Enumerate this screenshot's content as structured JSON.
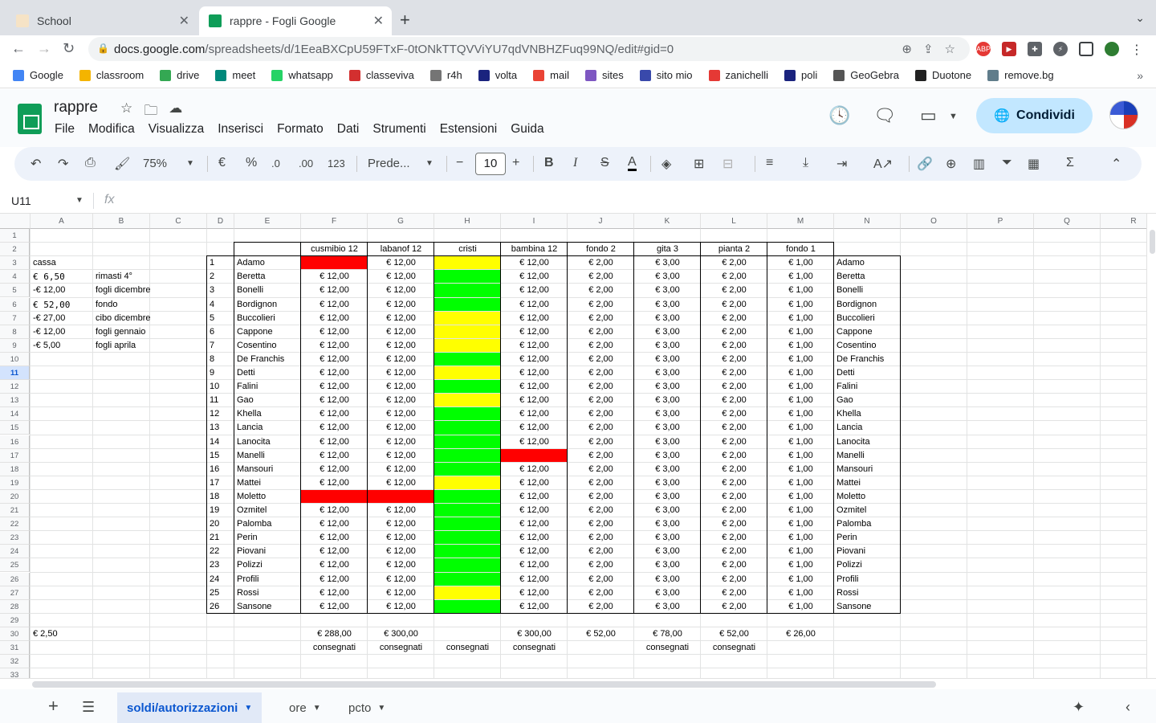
{
  "browser": {
    "tabs": [
      {
        "title": "School",
        "active": false
      },
      {
        "title": "rappre - Fogli Google",
        "active": true
      }
    ],
    "url_host": "docs.google.com",
    "url_path": "/spreadsheets/d/1EeaBXCpU59FTxF-0tONkTTQVViYU7qdVNBHZFuq99NQ/edit#gid=0",
    "bookmarks": [
      {
        "label": "Google",
        "color": "#4285f4"
      },
      {
        "label": "classroom",
        "color": "#f4b400"
      },
      {
        "label": "drive",
        "color": "#34a853"
      },
      {
        "label": "meet",
        "color": "#00897b"
      },
      {
        "label": "whatsapp",
        "color": "#25d366"
      },
      {
        "label": "classeviva",
        "color": "#d32f2f"
      },
      {
        "label": "r4h",
        "color": "#757575"
      },
      {
        "label": "volta",
        "color": "#1a237e"
      },
      {
        "label": "mail",
        "color": "#ea4335"
      },
      {
        "label": "sites",
        "color": "#7e57c2"
      },
      {
        "label": "sito mio",
        "color": "#3949ab"
      },
      {
        "label": "zanichelli",
        "color": "#e53935"
      },
      {
        "label": "poli",
        "color": "#1a237e"
      },
      {
        "label": "GeoGebra",
        "color": "#555555"
      },
      {
        "label": "Duotone",
        "color": "#212121"
      },
      {
        "label": "remove.bg",
        "color": "#607d8b"
      }
    ]
  },
  "doc": {
    "title": "rappre",
    "menu": [
      "File",
      "Modifica",
      "Visualizza",
      "Inserisci",
      "Formato",
      "Dati",
      "Strumenti",
      "Estensioni",
      "Guida"
    ],
    "share_label": "Condividi"
  },
  "toolbar": {
    "zoom": "75%",
    "currency": "€",
    "percent": "%",
    "dec_less": ".0",
    "dec_more": ".00",
    "format_123": "123",
    "font": "Prede...",
    "font_size": "10"
  },
  "formula_bar": {
    "name_box": "U11",
    "fx": "fx",
    "selected_row": 11
  },
  "sheet": {
    "columns": [
      "A",
      "B",
      "C",
      "D",
      "E",
      "F",
      "G",
      "H",
      "I",
      "J",
      "K",
      "L",
      "M",
      "N",
      "O",
      "P",
      "Q",
      "R"
    ],
    "rows": 33,
    "headers": {
      "F": "cusmibio 12",
      "G": "labanof 12",
      "H": "cristi",
      "I": "bambina 12",
      "J": "fondo 2",
      "K": "gita 3",
      "L": "pianta 2",
      "M": "fondo 1"
    },
    "cassa": [
      {
        "a": "cassa",
        "b": ""
      },
      {
        "a": "€ 6,50",
        "b": "rimasti 4°"
      },
      {
        "a": "-€ 12,00",
        "b": "fogli dicembre"
      },
      {
        "a": "€ 52,00",
        "b": "fondo"
      },
      {
        "a": "-€ 27,00",
        "b": "cibo dicembre"
      },
      {
        "a": "-€ 12,00",
        "b": "fogli gennaio"
      },
      {
        "a": "-€ 5,00",
        "b": "fogli aprila"
      }
    ],
    "a30": "€ 2,50",
    "students": [
      "Adamo",
      "Beretta",
      "Bonelli",
      "Bordignon",
      "Buccolieri",
      "Cappone",
      "Cosentino",
      "De Franchis",
      "Detti",
      "Falini",
      "Gao",
      "Khella",
      "Lancia",
      "Lanocita",
      "Manelli",
      "Mansouri",
      "Mattei",
      "Moletto",
      "Ozmitel",
      "Palomba",
      "Perin",
      "Piovani",
      "Polizzi",
      "Profili",
      "Rossi",
      "Sansone"
    ],
    "values": {
      "F": "€ 12,00",
      "G": "€ 12,00",
      "I": "€ 12,00",
      "J": "€ 2,00",
      "K": "€ 3,00",
      "L": "€ 2,00",
      "M": "€ 1,00"
    },
    "missing": {
      "F": [
        "Adamo",
        "Moletto"
      ],
      "G": [
        "Moletto"
      ],
      "I": [
        "Manelli"
      ]
    },
    "cristi_yellow": [
      "Adamo",
      "Buccolieri",
      "Cappone",
      "Cosentino",
      "Detti",
      "Gao",
      "Mattei",
      "Rossi"
    ],
    "colors": {
      "green": "#00ff00",
      "yellow": "#ffff00",
      "red": "#ff0000"
    },
    "totals": {
      "F": "€ 288,00",
      "G": "€ 300,00",
      "I": "€ 300,00",
      "J": "€ 52,00",
      "K": "€ 78,00",
      "L": "€ 52,00",
      "M": "€ 26,00"
    },
    "delivered_label": "consegnati",
    "delivered_cols": [
      "F",
      "G",
      "H",
      "I",
      "K",
      "L"
    ]
  },
  "sheet_tabs": [
    {
      "label": "soldi/autorizzazioni",
      "active": true
    },
    {
      "label": "ore",
      "active": false
    },
    {
      "label": "pcto",
      "active": false
    }
  ]
}
